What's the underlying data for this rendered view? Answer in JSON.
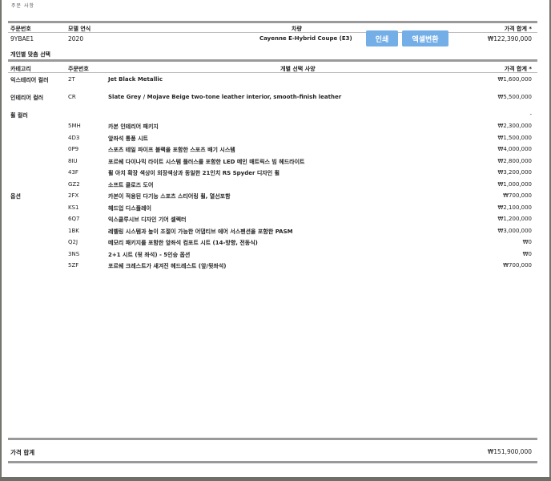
{
  "top_cut_text": "주문 사항",
  "order": {
    "headers": {
      "order_no": "주문번호",
      "model_year": "모델 연식",
      "vehicle": "차량",
      "price_total": "가격 합계 *"
    },
    "values": {
      "order_no": "9YBAE1",
      "model_year": "2020",
      "vehicle": "Cayenne E-Hybrid Coupe (E3)",
      "price_total": "₩122,390,000"
    }
  },
  "buttons": {
    "print": "인쇄",
    "excel": "엑셀변환"
  },
  "custom_section_title": "개인별 맞춤 선택",
  "options_headers": {
    "category": "카테고리",
    "order_no": "주문번호",
    "spec": "개별 선택 사양",
    "price_total": "가격 합계 *"
  },
  "rows": [
    {
      "category": "익스테리어 컬러",
      "code": "2T",
      "desc": "Jet Black Metallic",
      "price": "₩1,600,000"
    },
    {
      "category": "인테리어 컬러",
      "code": "CR",
      "desc": "Slate Grey / Mojave Beige two-tone leather interior, smooth-finish leather",
      "price": "₩5,500,000"
    },
    {
      "category": "휠 컬러",
      "code": "",
      "desc": "",
      "price": "-"
    },
    {
      "category": "",
      "code": "5MH",
      "desc": "카본 인테리어 패키지",
      "price": "₩2,300,000"
    },
    {
      "category": "",
      "code": "4D3",
      "desc": "앞좌석 통풍 시트",
      "price": "₩1,500,000"
    },
    {
      "category": "",
      "code": "0P9",
      "desc": "스포츠 테일 파이프 블랙을 포함한 스포츠 배기 시스템",
      "price": "₩4,000,000"
    },
    {
      "category": "",
      "code": "8IU",
      "desc": "포르쉐 다이나믹 라이트 시스템 플러스를 포함한 LED 메인 매트릭스 빔 헤드라이트",
      "price": "₩2,800,000"
    },
    {
      "category": "",
      "code": "43F",
      "desc": "휠 아치 확장 색상이 외장색상과 동일한 21인치 RS Spyder 디자인 휠",
      "price": "₩3,200,000"
    },
    {
      "category": "",
      "code": "GZ2",
      "desc": "소프트 클로즈 도어",
      "price": "₩1,000,000"
    },
    {
      "category": "옵션",
      "code": "2FX",
      "desc": "카본이 적용된 다기능 스포츠 스티어링 휠, 열선포함",
      "price": "₩700,000"
    },
    {
      "category": "",
      "code": "KS1",
      "desc": "헤드업 디스플레이",
      "price": "₩2,100,000"
    },
    {
      "category": "",
      "code": "6Q7",
      "desc": "익스클루시브 디자인 기어 셀렉터",
      "price": "₩1,200,000"
    },
    {
      "category": "",
      "code": "1BK",
      "desc": "레벨링 시스템과 높이 조절이 가능한 어댑티브 에어 서스펜션을 포함한 PASM",
      "price": "₩3,000,000"
    },
    {
      "category": "",
      "code": "Q2J",
      "desc": "메모리 패키지를 포함한 앞좌석 컴포트 시트 (14-방향, 전동식)",
      "price": "₩0"
    },
    {
      "category": "",
      "code": "3NS",
      "desc": "2+1 시트 (뒷 좌석) - 5인승 옵션",
      "price": "₩0"
    },
    {
      "category": "",
      "code": "5ZF",
      "desc": "포르쉐 크레스트가 새겨진 헤드레스트 (앞/뒷좌석)",
      "price": "₩700,000"
    }
  ],
  "footer": {
    "label": "가격 합계",
    "value": "₩151,900,000"
  }
}
